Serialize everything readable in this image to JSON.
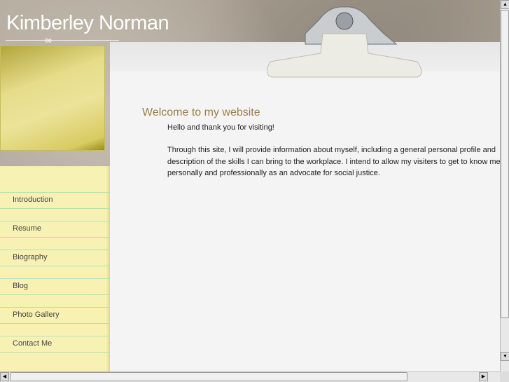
{
  "header": {
    "title": "Kimberley Norman"
  },
  "nav": {
    "items": [
      {
        "label": "Introduction"
      },
      {
        "label": "Resume"
      },
      {
        "label": "Biography"
      },
      {
        "label": "Blog"
      },
      {
        "label": "Photo Gallery"
      },
      {
        "label": "Contact Me"
      }
    ]
  },
  "main": {
    "heading": "Welcome to my website",
    "greeting": "Hello and thank you for visiting!",
    "paragraph_lines": [
      "Through this site, I will provide information about myself, including a general personal profile and",
      "description of the skills I can bring to the workplace.  I intend to allow my visiters to get to know me",
      "personally and professionally as an advocate for social justice."
    ]
  },
  "colors": {
    "heading": "#9c7f4a",
    "nav_bg": "#f7f2b4",
    "nav_line": "#b7dfb2"
  }
}
